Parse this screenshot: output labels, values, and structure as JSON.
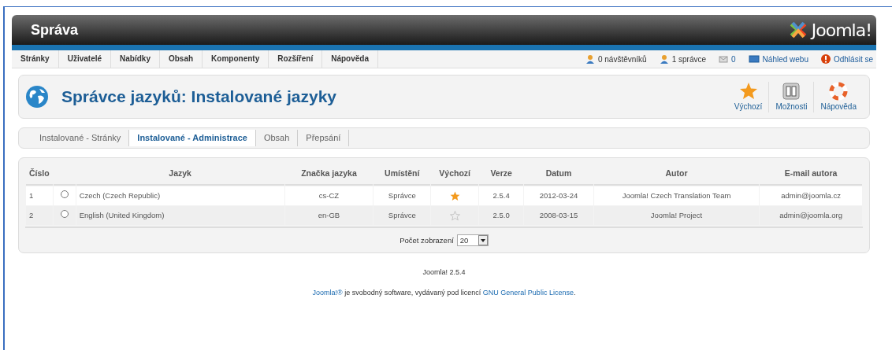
{
  "header": {
    "title": "Správa",
    "logo_text": "Joomla!"
  },
  "menu": [
    "Stránky",
    "Uživatelé",
    "Nabídky",
    "Obsah",
    "Komponenty",
    "Rozšíření",
    "Nápověda"
  ],
  "status": [
    {
      "kind": "visitors",
      "text": "0 návštěvníků"
    },
    {
      "kind": "admins",
      "text": "1 správce"
    },
    {
      "kind": "messages",
      "text": "0"
    },
    {
      "kind": "preview",
      "text": "Náhled webu"
    },
    {
      "kind": "logout",
      "text": "Odhlásit se"
    }
  ],
  "page_title": "Správce jazyků: Instalované jazyky",
  "toolbar": [
    {
      "kind": "default",
      "label": "Výchozí"
    },
    {
      "kind": "options",
      "label": "Možnosti"
    },
    {
      "kind": "help",
      "label": "Nápověda"
    }
  ],
  "submenu": [
    {
      "label": "Instalované - Stránky",
      "selected": false
    },
    {
      "label": "Instalované - Administrace",
      "selected": true
    },
    {
      "label": "Obsah",
      "selected": false
    },
    {
      "label": "Přepsání",
      "selected": false
    }
  ],
  "table": {
    "columns": [
      "Číslo",
      "",
      "Jazyk",
      "Značka jazyka",
      "Umístění",
      "Výchozí",
      "Verze",
      "Datum",
      "Autor",
      "E-mail autora"
    ],
    "rows": [
      {
        "number": "1",
        "selected": false,
        "language": "Czech (Czech Republic)",
        "tag": "cs-CZ",
        "location": "Správce",
        "default": true,
        "version": "2.5.4",
        "date": "2012-03-24",
        "author": "Joomla! Czech Translation Team",
        "email": "admin@joomla.cz"
      },
      {
        "number": "2",
        "selected": false,
        "language": "English (United Kingdom)",
        "tag": "en-GB",
        "location": "Správce",
        "default": false,
        "version": "2.5.0",
        "date": "2008-03-15",
        "author": "Joomla! Project",
        "email": "admin@joomla.org"
      }
    ],
    "pagination": {
      "label": "Počet zobrazení",
      "value": "20"
    }
  },
  "footer": {
    "version": "Joomla! 2.5.4",
    "notice": [
      {
        "kind": "link",
        "text": "Joomla!®"
      },
      {
        "kind": "text",
        "text": " je svobodný software, vydávaný pod licencí "
      },
      {
        "kind": "link",
        "text": "GNU General Public License"
      },
      {
        "kind": "text",
        "text": "."
      }
    ]
  }
}
